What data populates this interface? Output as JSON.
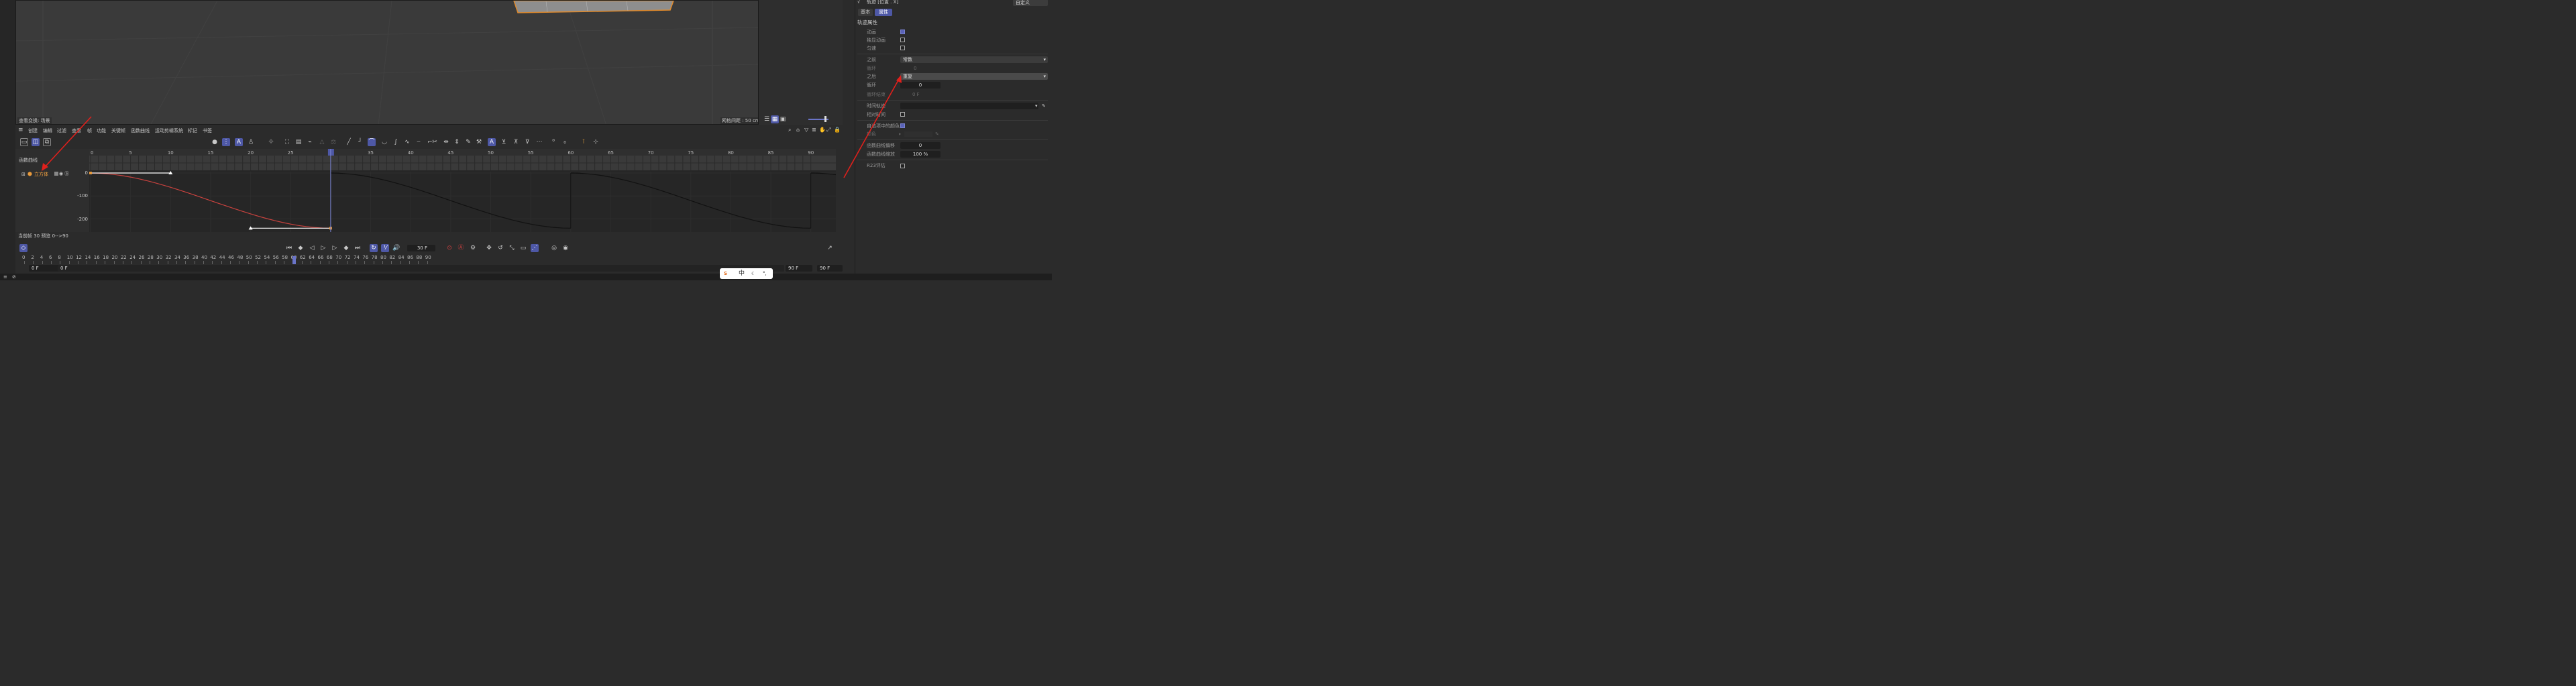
{
  "viewport": {
    "status_left": "查看变换: 场景",
    "status_right": "网格间距 : 50 cm"
  },
  "timeline": {
    "menu": [
      "创建",
      "编辑",
      "过滤",
      "查看",
      "帧",
      "功能",
      "关键帧",
      "函数曲线",
      "运动剪辑系统",
      "标记",
      "书签"
    ],
    "panel_label": "函数曲线",
    "object_name": "立方体",
    "ruler_ticks": [
      "0",
      "5",
      "10",
      "15",
      "20",
      "25",
      "30",
      "35",
      "40",
      "45",
      "50",
      "55",
      "60",
      "65",
      "70",
      "75",
      "80",
      "85",
      "90"
    ],
    "y_ticks": [
      "0",
      "-100",
      "-200"
    ],
    "current_frame_status": "当前帧 30  预览 0-->90",
    "accent": "#4e58a6",
    "curve_color": "#c8423e"
  },
  "transport": {
    "frame_value": "30 F",
    "ruler_ticks": [
      "0",
      "2",
      "4",
      "6",
      "8",
      "10",
      "12",
      "14",
      "16",
      "18",
      "20",
      "22",
      "24",
      "26",
      "28",
      "30",
      "32",
      "34",
      "36",
      "38",
      "40",
      "42",
      "44",
      "46",
      "48",
      "50",
      "52",
      "54",
      "56",
      "58",
      "60",
      "62",
      "64",
      "66",
      "68",
      "70",
      "72",
      "74",
      "76",
      "78",
      "80",
      "82",
      "84",
      "86",
      "88",
      "90"
    ],
    "start_field": "0 F",
    "start_field2": "0 F",
    "end_field": "90 F",
    "end_field2": "90 F"
  },
  "ime": {
    "lang": "中"
  },
  "attributes": {
    "title": "轨迹 [位置 . X]",
    "preset": "自定义",
    "tabs": [
      {
        "label": "基本"
      },
      {
        "label": "属性"
      }
    ],
    "section": "轨迹属性",
    "rows": {
      "animate": "动画",
      "solo": "独显动画",
      "smooth": "匀速",
      "before": "之前",
      "before_value": "常数",
      "loop1": "循环",
      "loop1_value": "0",
      "after": "之后",
      "after_value": "重复",
      "loop2": "循环",
      "loop2_value": "0",
      "loop_end": "循环结束",
      "loop_end_value": "0 F",
      "time_track": "时间轨迹",
      "relative": "相对时间",
      "custom_color": "自选项中的颜色",
      "color": "颜色",
      "curve_offset": "函数曲线偏移",
      "curve_offset_value": "0",
      "curve_scale": "函数曲线缩放",
      "curve_scale_value": "100 %",
      "r23": "R23评估"
    }
  }
}
